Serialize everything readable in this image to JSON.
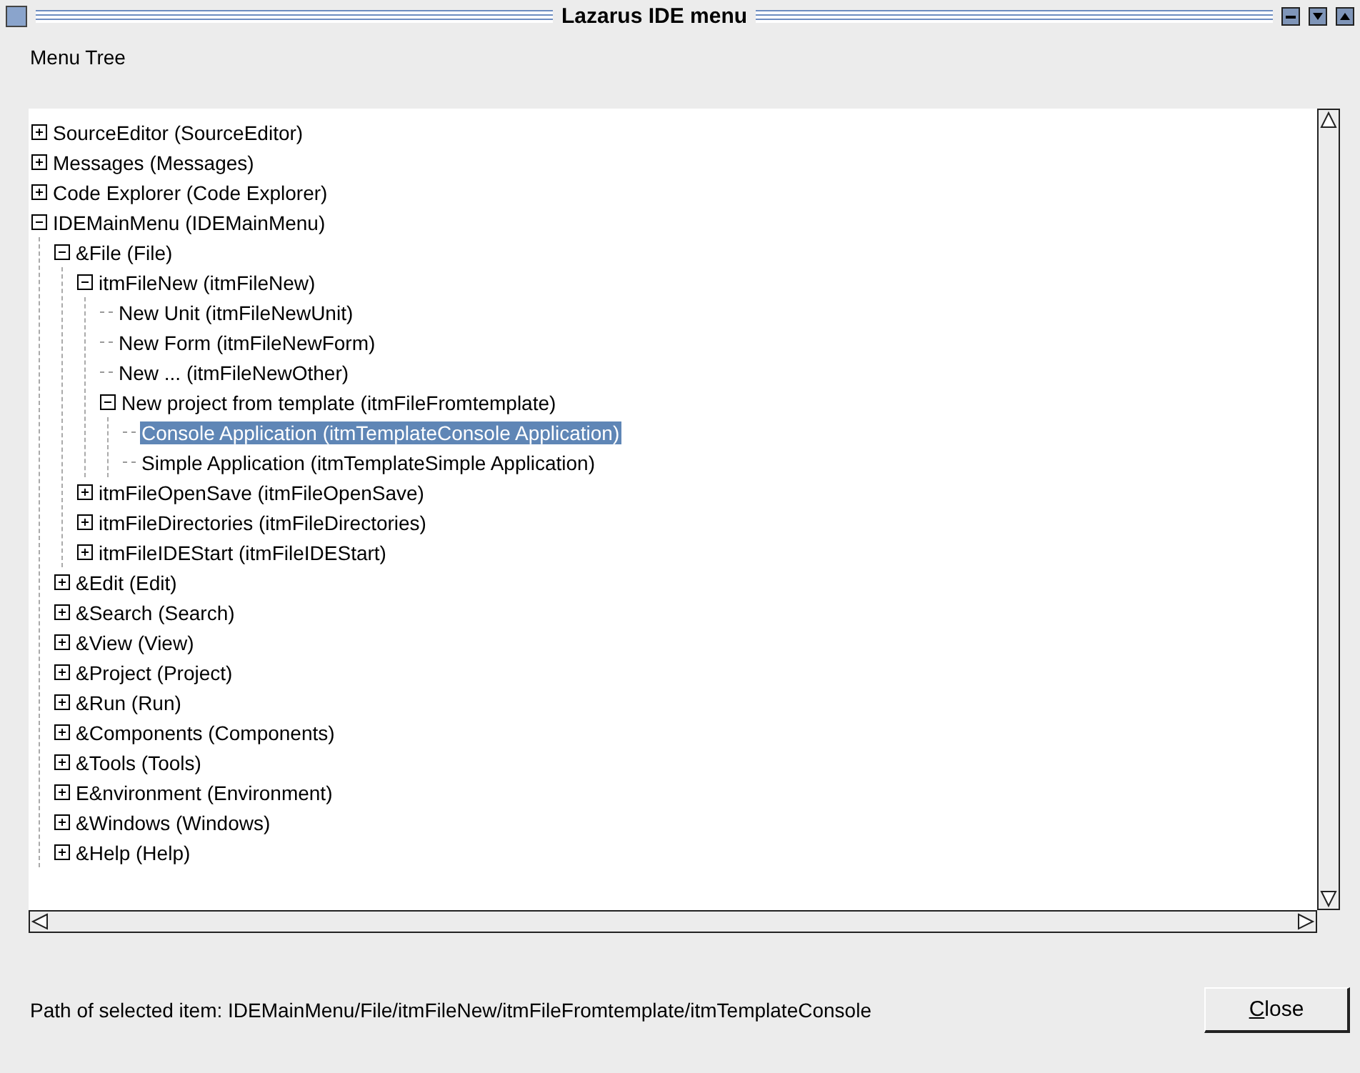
{
  "window": {
    "title": "Lazarus IDE menu"
  },
  "label": "Menu Tree",
  "tree": [
    {
      "text": "SourceEditor (SourceEditor)",
      "expanded": false,
      "selected": false
    },
    {
      "text": "Messages (Messages)",
      "expanded": false,
      "selected": false
    },
    {
      "text": "Code Explorer (Code Explorer)",
      "expanded": false,
      "selected": false
    },
    {
      "text": "IDEMainMenu (IDEMainMenu)",
      "expanded": true,
      "selected": false,
      "children": [
        {
          "text": "&File (File)",
          "expanded": true,
          "selected": false,
          "children": [
            {
              "text": "itmFileNew (itmFileNew)",
              "expanded": true,
              "selected": false,
              "children": [
                {
                  "text": "New Unit (itmFileNewUnit)",
                  "selected": false
                },
                {
                  "text": "New Form (itmFileNewForm)",
                  "selected": false
                },
                {
                  "text": "New ... (itmFileNewOther)",
                  "selected": false
                },
                {
                  "text": "New project from template (itmFileFromtemplate)",
                  "expanded": true,
                  "selected": false,
                  "children": [
                    {
                      "text": "Console Application (itmTemplateConsole Application)",
                      "selected": true
                    },
                    {
                      "text": "Simple Application (itmTemplateSimple Application)",
                      "selected": false
                    }
                  ]
                }
              ]
            },
            {
              "text": "itmFileOpenSave (itmFileOpenSave)",
              "expanded": false,
              "selected": false
            },
            {
              "text": "itmFileDirectories (itmFileDirectories)",
              "expanded": false,
              "selected": false
            },
            {
              "text": "itmFileIDEStart (itmFileIDEStart)",
              "expanded": false,
              "selected": false
            }
          ]
        },
        {
          "text": "&Edit (Edit)",
          "expanded": false,
          "selected": false
        },
        {
          "text": "&Search (Search)",
          "expanded": false,
          "selected": false
        },
        {
          "text": "&View (View)",
          "expanded": false,
          "selected": false
        },
        {
          "text": "&Project (Project)",
          "expanded": false,
          "selected": false
        },
        {
          "text": "&Run (Run)",
          "expanded": false,
          "selected": false
        },
        {
          "text": "&Components (Components)",
          "expanded": false,
          "selected": false
        },
        {
          "text": "&Tools (Tools)",
          "expanded": false,
          "selected": false
        },
        {
          "text": "E&nvironment (Environment)",
          "expanded": false,
          "selected": false
        },
        {
          "text": "&Windows (Windows)",
          "expanded": false,
          "selected": false
        },
        {
          "text": "&Help (Help)",
          "expanded": false,
          "selected": false
        }
      ]
    }
  ],
  "path": "Path of selected item: IDEMainMenu/File/itmFileNew/itmFileFromtemplate/itmTemplateConsole",
  "close_button": "Close"
}
